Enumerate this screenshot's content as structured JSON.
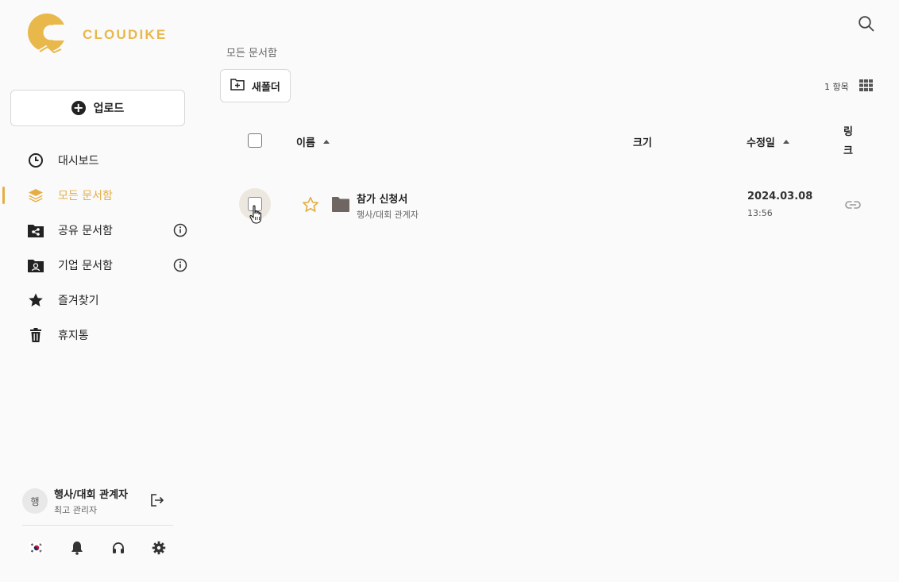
{
  "brand": {
    "name": "CLOUDIKE",
    "color": "#e8b84a"
  },
  "sidebar": {
    "upload_label": "업로드",
    "items": [
      {
        "label": "대시보드",
        "icon": "clock-icon"
      },
      {
        "label": "모든 문서함",
        "icon": "layers-icon",
        "active": true
      },
      {
        "label": "공유 문서함",
        "icon": "shared-folder-icon",
        "info": true
      },
      {
        "label": "기업 문서함",
        "icon": "company-folder-icon",
        "info": true
      },
      {
        "label": "즐겨찾기",
        "icon": "star-icon"
      },
      {
        "label": "휴지통",
        "icon": "trash-icon"
      }
    ],
    "user": {
      "avatar": "행",
      "name": "행사/대회 관계자",
      "role": "최고 관리자"
    }
  },
  "main": {
    "breadcrumb": "모든 문서함",
    "new_folder_label": "새폴더",
    "item_count": "1 항목",
    "columns": {
      "name": "이름",
      "size": "크기",
      "modified": "수정일",
      "link": "링크"
    },
    "rows": [
      {
        "name": "참가 신청서",
        "owner": "행사/대회 관계자",
        "date": "2024.03.08",
        "time": "13:56",
        "starred": false
      }
    ]
  },
  "colors": {
    "accent": "#e5ae45",
    "folder": "#6f6661"
  }
}
